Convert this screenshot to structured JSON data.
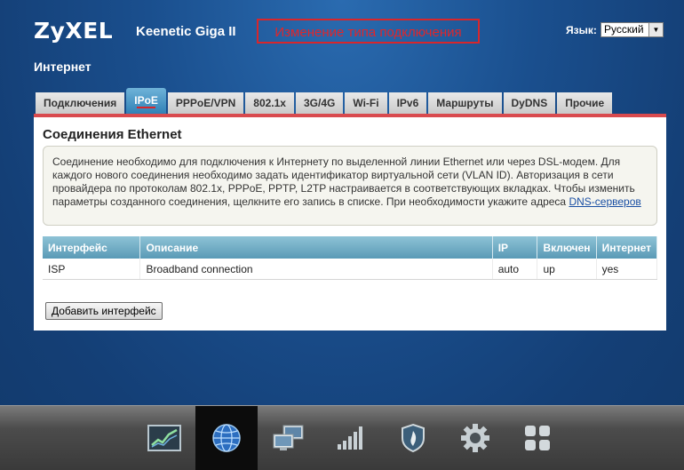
{
  "header": {
    "brand": "ZyXEL",
    "model": "Keenetic Giga II",
    "annotation": "Изменение типа подключения",
    "language_label": "Язык:",
    "language_value": "Русский"
  },
  "page": {
    "title": "Интернет"
  },
  "tabs": [
    {
      "label": "Подключения"
    },
    {
      "label": "IPoE",
      "active": true
    },
    {
      "label": "PPPoE/VPN"
    },
    {
      "label": "802.1x"
    },
    {
      "label": "3G/4G"
    },
    {
      "label": "Wi-Fi"
    },
    {
      "label": "IPv6"
    },
    {
      "label": "Маршруты"
    },
    {
      "label": "DyDNS"
    },
    {
      "label": "Прочие"
    }
  ],
  "section": {
    "title": "Соединения Ethernet",
    "info_text": "Соединение необходимо для подключения к Интернету по выделенной линии Ethernet или через DSL-модем. Для каждого нового соединения необходимо задать идентификатор виртуальной сети (VLAN ID). Авторизация в сети провайдера по протоколам 802.1x, PPPoE, PPTP, L2TP настраивается в соответствующих вкладках. Чтобы изменить параметры созданного соединения, щелкните его запись в списке. При необходимости укажите адреса ",
    "info_link": "DNS-серверов"
  },
  "table": {
    "columns": [
      "Интерфейс",
      "Описание",
      "IP",
      "Включен",
      "Интернет"
    ],
    "rows": [
      [
        "ISP",
        "Broadband connection",
        "auto",
        "up",
        "yes"
      ]
    ]
  },
  "add_button": "Добавить интерфейс",
  "dock": [
    {
      "icon": "chart-icon"
    },
    {
      "icon": "globe-icon",
      "active": true
    },
    {
      "icon": "network-computers-icon"
    },
    {
      "icon": "signal-bars-icon"
    },
    {
      "icon": "shield-icon"
    },
    {
      "icon": "gear-icon"
    },
    {
      "icon": "apps-grid-icon"
    }
  ],
  "colors": {
    "background": "#1a4f8e",
    "accent_red": "#d8262b",
    "tab_active": "#2e7fb5",
    "table_header": "#5a9ab6"
  }
}
